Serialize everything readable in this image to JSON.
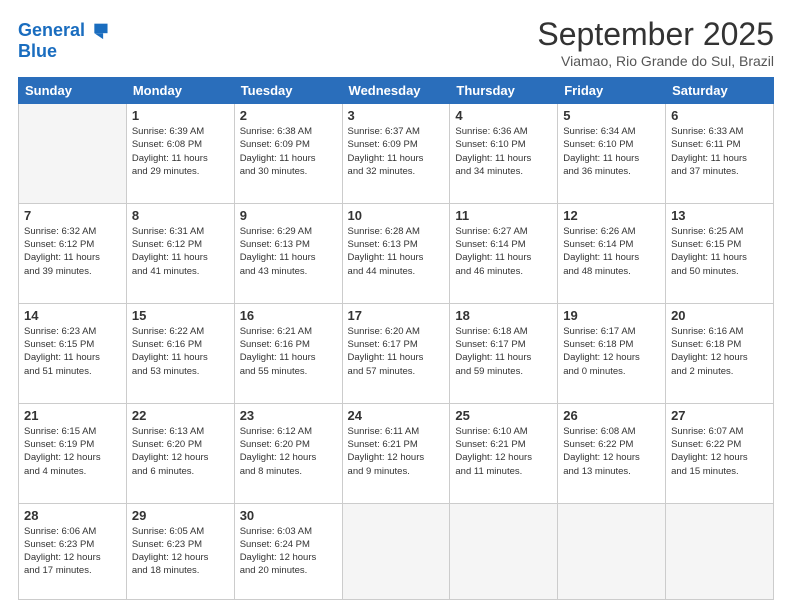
{
  "logo": {
    "line1": "General",
    "line2": "Blue"
  },
  "title": "September 2025",
  "subtitle": "Viamao, Rio Grande do Sul, Brazil",
  "days_of_week": [
    "Sunday",
    "Monday",
    "Tuesday",
    "Wednesday",
    "Thursday",
    "Friday",
    "Saturday"
  ],
  "weeks": [
    [
      {
        "day": "",
        "info": ""
      },
      {
        "day": "1",
        "info": "Sunrise: 6:39 AM\nSunset: 6:08 PM\nDaylight: 11 hours\nand 29 minutes."
      },
      {
        "day": "2",
        "info": "Sunrise: 6:38 AM\nSunset: 6:09 PM\nDaylight: 11 hours\nand 30 minutes."
      },
      {
        "day": "3",
        "info": "Sunrise: 6:37 AM\nSunset: 6:09 PM\nDaylight: 11 hours\nand 32 minutes."
      },
      {
        "day": "4",
        "info": "Sunrise: 6:36 AM\nSunset: 6:10 PM\nDaylight: 11 hours\nand 34 minutes."
      },
      {
        "day": "5",
        "info": "Sunrise: 6:34 AM\nSunset: 6:10 PM\nDaylight: 11 hours\nand 36 minutes."
      },
      {
        "day": "6",
        "info": "Sunrise: 6:33 AM\nSunset: 6:11 PM\nDaylight: 11 hours\nand 37 minutes."
      }
    ],
    [
      {
        "day": "7",
        "info": "Sunrise: 6:32 AM\nSunset: 6:12 PM\nDaylight: 11 hours\nand 39 minutes."
      },
      {
        "day": "8",
        "info": "Sunrise: 6:31 AM\nSunset: 6:12 PM\nDaylight: 11 hours\nand 41 minutes."
      },
      {
        "day": "9",
        "info": "Sunrise: 6:29 AM\nSunset: 6:13 PM\nDaylight: 11 hours\nand 43 minutes."
      },
      {
        "day": "10",
        "info": "Sunrise: 6:28 AM\nSunset: 6:13 PM\nDaylight: 11 hours\nand 44 minutes."
      },
      {
        "day": "11",
        "info": "Sunrise: 6:27 AM\nSunset: 6:14 PM\nDaylight: 11 hours\nand 46 minutes."
      },
      {
        "day": "12",
        "info": "Sunrise: 6:26 AM\nSunset: 6:14 PM\nDaylight: 11 hours\nand 48 minutes."
      },
      {
        "day": "13",
        "info": "Sunrise: 6:25 AM\nSunset: 6:15 PM\nDaylight: 11 hours\nand 50 minutes."
      }
    ],
    [
      {
        "day": "14",
        "info": "Sunrise: 6:23 AM\nSunset: 6:15 PM\nDaylight: 11 hours\nand 51 minutes."
      },
      {
        "day": "15",
        "info": "Sunrise: 6:22 AM\nSunset: 6:16 PM\nDaylight: 11 hours\nand 53 minutes."
      },
      {
        "day": "16",
        "info": "Sunrise: 6:21 AM\nSunset: 6:16 PM\nDaylight: 11 hours\nand 55 minutes."
      },
      {
        "day": "17",
        "info": "Sunrise: 6:20 AM\nSunset: 6:17 PM\nDaylight: 11 hours\nand 57 minutes."
      },
      {
        "day": "18",
        "info": "Sunrise: 6:18 AM\nSunset: 6:17 PM\nDaylight: 11 hours\nand 59 minutes."
      },
      {
        "day": "19",
        "info": "Sunrise: 6:17 AM\nSunset: 6:18 PM\nDaylight: 12 hours\nand 0 minutes."
      },
      {
        "day": "20",
        "info": "Sunrise: 6:16 AM\nSunset: 6:18 PM\nDaylight: 12 hours\nand 2 minutes."
      }
    ],
    [
      {
        "day": "21",
        "info": "Sunrise: 6:15 AM\nSunset: 6:19 PM\nDaylight: 12 hours\nand 4 minutes."
      },
      {
        "day": "22",
        "info": "Sunrise: 6:13 AM\nSunset: 6:20 PM\nDaylight: 12 hours\nand 6 minutes."
      },
      {
        "day": "23",
        "info": "Sunrise: 6:12 AM\nSunset: 6:20 PM\nDaylight: 12 hours\nand 8 minutes."
      },
      {
        "day": "24",
        "info": "Sunrise: 6:11 AM\nSunset: 6:21 PM\nDaylight: 12 hours\nand 9 minutes."
      },
      {
        "day": "25",
        "info": "Sunrise: 6:10 AM\nSunset: 6:21 PM\nDaylight: 12 hours\nand 11 minutes."
      },
      {
        "day": "26",
        "info": "Sunrise: 6:08 AM\nSunset: 6:22 PM\nDaylight: 12 hours\nand 13 minutes."
      },
      {
        "day": "27",
        "info": "Sunrise: 6:07 AM\nSunset: 6:22 PM\nDaylight: 12 hours\nand 15 minutes."
      }
    ],
    [
      {
        "day": "28",
        "info": "Sunrise: 6:06 AM\nSunset: 6:23 PM\nDaylight: 12 hours\nand 17 minutes."
      },
      {
        "day": "29",
        "info": "Sunrise: 6:05 AM\nSunset: 6:23 PM\nDaylight: 12 hours\nand 18 minutes."
      },
      {
        "day": "30",
        "info": "Sunrise: 6:03 AM\nSunset: 6:24 PM\nDaylight: 12 hours\nand 20 minutes."
      },
      {
        "day": "",
        "info": ""
      },
      {
        "day": "",
        "info": ""
      },
      {
        "day": "",
        "info": ""
      },
      {
        "day": "",
        "info": ""
      }
    ]
  ]
}
